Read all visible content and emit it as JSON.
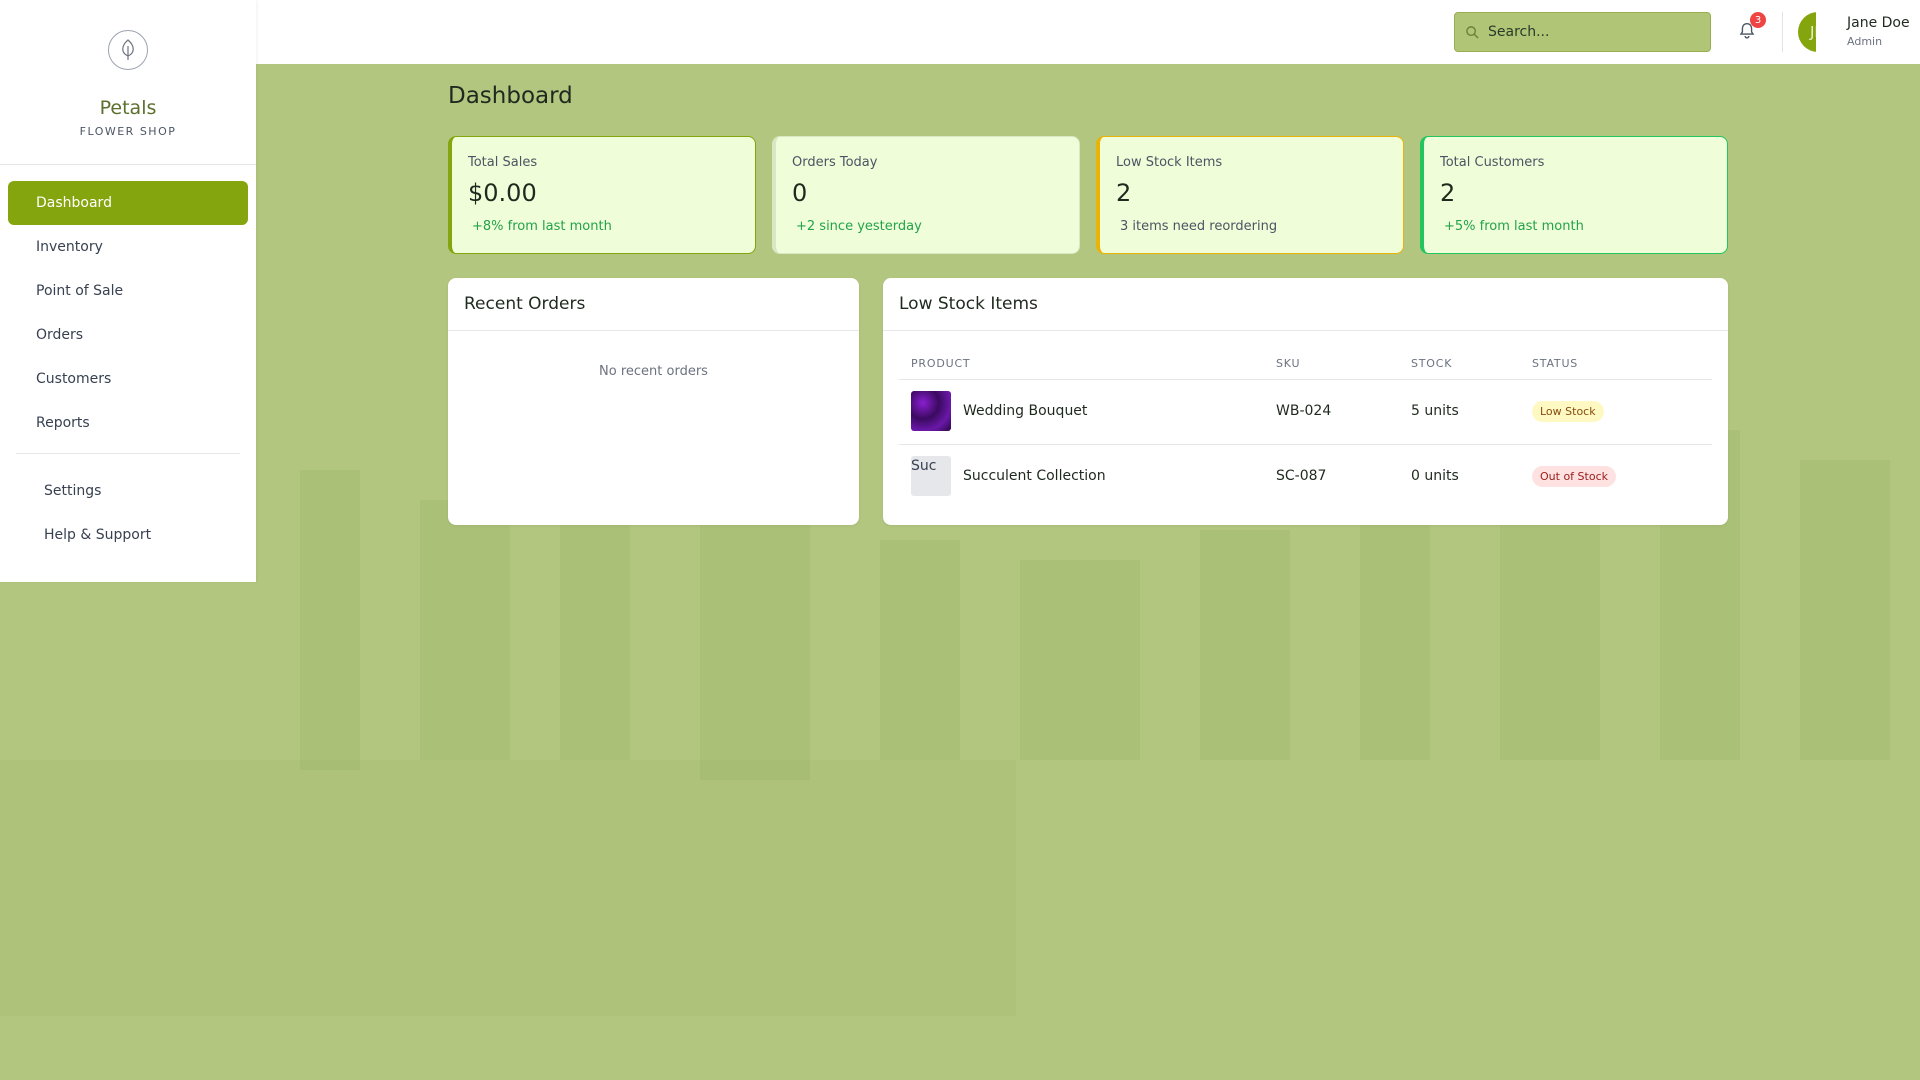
{
  "brand": {
    "name": "Petals",
    "subtitle": "FLOWER SHOP"
  },
  "sidebar": {
    "items": [
      {
        "label": "Dashboard",
        "active": true
      },
      {
        "label": "Inventory"
      },
      {
        "label": "Point of Sale"
      },
      {
        "label": "Orders"
      },
      {
        "label": "Customers"
      },
      {
        "label": "Reports"
      }
    ],
    "secondary": [
      {
        "label": "Settings"
      },
      {
        "label": "Help & Support"
      }
    ]
  },
  "header": {
    "search_placeholder": "Search...",
    "notification_count": "3",
    "user": {
      "initials": "JD",
      "name": "Jane Doe",
      "role": "Admin"
    }
  },
  "page": {
    "title": "Dashboard"
  },
  "stats": [
    {
      "label": "Total Sales",
      "value": "$0.00",
      "note": "+8% from last month"
    },
    {
      "label": "Orders Today",
      "value": "0",
      "note": "+2 since yesterday"
    },
    {
      "label": "Low Stock Items",
      "value": "2",
      "note": "3 items need reordering"
    },
    {
      "label": "Total Customers",
      "value": "2",
      "note": "+5% from last month"
    }
  ],
  "recent_orders": {
    "title": "Recent Orders",
    "empty_text": "No recent orders"
  },
  "low_stock": {
    "title": "Low Stock Items",
    "columns": [
      "PRODUCT",
      "SKU",
      "STOCK",
      "STATUS"
    ],
    "rows": [
      {
        "product": "Wedding Bouquet",
        "sku": "WB-024",
        "stock": "5 units",
        "status": "Low Stock",
        "thumb_alt": ""
      },
      {
        "product": "Succulent Collection",
        "sku": "SC-087",
        "stock": "0 units",
        "status": "Out of Stock",
        "thumb_alt": "Suc"
      }
    ]
  },
  "colors": {
    "accent": "#84a50e",
    "background": "#b3c67f",
    "card_bg": "#f0fdd9",
    "positive": "#22a34a",
    "warning": "#eab308",
    "danger": "#ef4444"
  }
}
